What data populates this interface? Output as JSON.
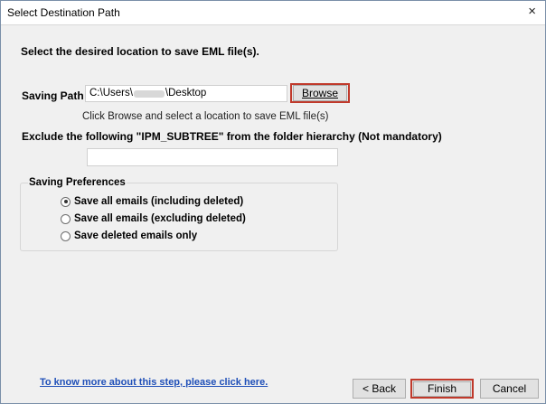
{
  "window": {
    "title": "Select Destination Path",
    "close_glyph": "×"
  },
  "main": {
    "heading": "Select the desired location to save EML file(s).",
    "saving_path_label": "Saving Path",
    "saving_path_prefix": "C:\\Users\\",
    "saving_path_suffix": "\\Desktop",
    "browse_label": "Browse",
    "browse_hint": "Click Browse and select a location to save EML file(s)",
    "exclude_label": "Exclude the following \"IPM_SUBTREE\" from the folder hierarchy (Not mandatory)",
    "exclude_value": ""
  },
  "preferences": {
    "legend": "Saving Preferences",
    "options": [
      {
        "label": "Save all emails (including deleted)",
        "selected": true
      },
      {
        "label": "Save all emails (excluding deleted)",
        "selected": false
      },
      {
        "label": "Save deleted emails only",
        "selected": false
      }
    ]
  },
  "footer": {
    "help_link": "To know more about this step, please click here.",
    "back_label": "< Back",
    "finish_label": "Finish",
    "cancel_label": "Cancel"
  },
  "colors": {
    "highlight": "#c0392b",
    "link": "#1f4fb8",
    "window_bg": "#f0f0f0"
  }
}
